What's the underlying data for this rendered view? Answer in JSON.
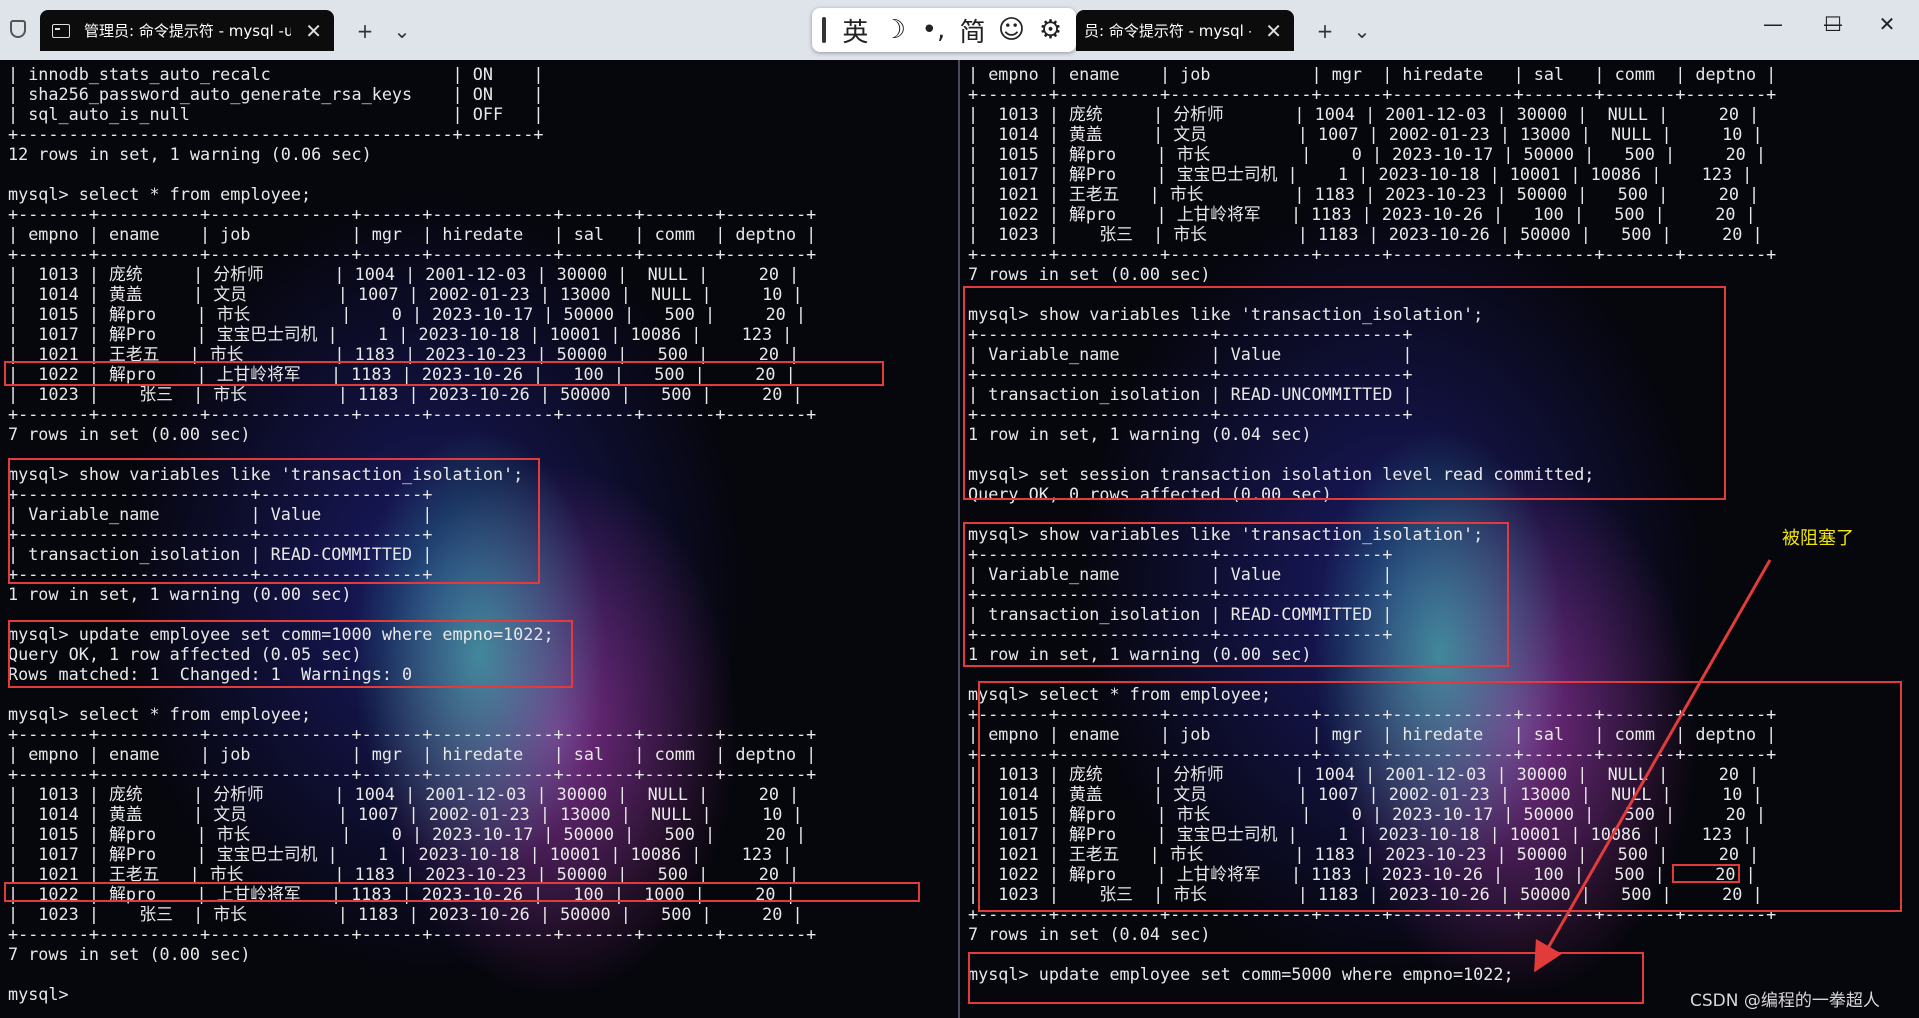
{
  "window": {
    "tabs": [
      {
        "title": "管理员: 命令提示符 - mysql  -u"
      },
      {
        "title": "员: 命令提示符 - mysql  -u"
      }
    ],
    "new_tab_symbol": "+",
    "dropdown_symbol": "⌄",
    "close_symbol": "✕",
    "controls": {
      "minimize": "—",
      "maximize": "☐",
      "close": "✕"
    }
  },
  "ime": {
    "lang": "英",
    "moon": "☽",
    "punct": "•,",
    "simplified": "简",
    "emoji": "☺",
    "settings": "⚙"
  },
  "left_terminal": {
    "lines": [
      "| innodb_stats_auto_recalc                  | ON    |",
      "| sha256_password_auto_generate_rsa_keys    | ON    |",
      "| sql_auto_is_null                          | OFF   |",
      "+-------------------------------------------+-------+",
      "12 rows in set, 1 warning (0.06 sec)",
      "",
      "mysql> select * from employee;",
      "+-------+----------+--------------+------+------------+-------+-------+--------+",
      "| empno | ename    | job          | mgr  | hiredate   | sal   | comm  | deptno |",
      "+-------+----------+--------------+------+------------+-------+-------+--------+",
      "|  1013 | 庞统     | 分析师       | 1004 | 2001-12-03 | 30000 |  NULL |     20 |",
      "|  1014 | 黄盖     | 文员         | 1007 | 2002-01-23 | 13000 |  NULL |     10 |",
      "|  1015 | 解pro    | 市长         |    0 | 2023-10-17 | 50000 |   500 |     20 |",
      "|  1017 | 解Pro    | 宝宝巴士司机 |    1 | 2023-10-18 | 10001 | 10086 |    123 |",
      "|  1021 | 王老五   | 市长         | 1183 | 2023-10-23 | 50000 |   500 |     20 |",
      "|  1022 | 解pro    | 上甘岭将军   | 1183 | 2023-10-26 |   100 |   500 |     20 |",
      "|  1023 |    张三  | 市长         | 1183 | 2023-10-26 | 50000 |   500 |     20 |",
      "+-------+----------+--------------+------+------------+-------+-------+--------+",
      "7 rows in set (0.00 sec)",
      "",
      "mysql> show variables like 'transaction_isolation';",
      "+-----------------------+----------------+",
      "| Variable_name         | Value          |",
      "+-----------------------+----------------+",
      "| transaction_isolation | READ-COMMITTED |",
      "+-----------------------+----------------+",
      "1 row in set, 1 warning (0.00 sec)",
      "",
      "mysql> update employee set comm=1000 where empno=1022;",
      "Query OK, 1 row affected (0.05 sec)",
      "Rows matched: 1  Changed: 1  Warnings: 0",
      "",
      "mysql> select * from employee;",
      "+-------+----------+--------------+------+------------+-------+-------+--------+",
      "| empno | ename    | job          | mgr  | hiredate   | sal   | comm  | deptno |",
      "+-------+----------+--------------+------+------------+-------+-------+--------+",
      "|  1013 | 庞统     | 分析师       | 1004 | 2001-12-03 | 30000 |  NULL |     20 |",
      "|  1014 | 黄盖     | 文员         | 1007 | 2002-01-23 | 13000 |  NULL |     10 |",
      "|  1015 | 解pro    | 市长         |    0 | 2023-10-17 | 50000 |   500 |     20 |",
      "|  1017 | 解Pro    | 宝宝巴士司机 |    1 | 2023-10-18 | 10001 | 10086 |    123 |",
      "|  1021 | 王老五   | 市长         | 1183 | 2023-10-23 | 50000 |   500 |     20 |",
      "|  1022 | 解pro    | 上甘岭将军   | 1183 | 2023-10-26 |   100 |  1000 |     20 |",
      "|  1023 |    张三  | 市长         | 1183 | 2023-10-26 | 50000 |   500 |     20 |",
      "+-------+----------+--------------+------+------------+-------+-------+--------+",
      "7 rows in set (0.00 sec)",
      "",
      "mysql>"
    ]
  },
  "right_terminal": {
    "lines": [
      "| empno | ename    | job          | mgr  | hiredate   | sal   | comm  | deptno |",
      "+-------+----------+--------------+------+------------+-------+-------+--------+",
      "|  1013 | 庞统     | 分析师       | 1004 | 2001-12-03 | 30000 |  NULL |     20 |",
      "|  1014 | 黄盖     | 文员         | 1007 | 2002-01-23 | 13000 |  NULL |     10 |",
      "|  1015 | 解pro    | 市长         |    0 | 2023-10-17 | 50000 |   500 |     20 |",
      "|  1017 | 解Pro    | 宝宝巴士司机 |    1 | 2023-10-18 | 10001 | 10086 |    123 |",
      "|  1021 | 王老五   | 市长         | 1183 | 2023-10-23 | 50000 |   500 |     20 |",
      "|  1022 | 解pro    | 上甘岭将军   | 1183 | 2023-10-26 |   100 |   500 |     20 |",
      "|  1023 |    张三  | 市长         | 1183 | 2023-10-26 | 50000 |   500 |     20 |",
      "+-------+----------+--------------+------+------------+-------+-------+--------+",
      "7 rows in set (0.00 sec)",
      "",
      "mysql> show variables like 'transaction_isolation';",
      "+-----------------------+------------------+",
      "| Variable_name         | Value            |",
      "+-----------------------+------------------+",
      "| transaction_isolation | READ-UNCOMMITTED |",
      "+-----------------------+------------------+",
      "1 row in set, 1 warning (0.04 sec)",
      "",
      "mysql> set session transaction isolation level read committed;",
      "Query OK, 0 rows affected (0.00 sec)",
      "",
      "mysql> show variables like 'transaction_isolation';",
      "+-----------------------+----------------+",
      "| Variable_name         | Value          |",
      "+-----------------------+----------------+",
      "| transaction_isolation | READ-COMMITTED |",
      "+-----------------------+----------------+",
      "1 row in set, 1 warning (0.00 sec)",
      "",
      "mysql> select * from employee;",
      "+-------+----------+--------------+------+------------+-------+-------+--------+",
      "| empno | ename    | job          | mgr  | hiredate   | sal   | comm  | deptno |",
      "+-------+----------+--------------+------+------------+-------+-------+--------+",
      "|  1013 | 庞统     | 分析师       | 1004 | 2001-12-03 | 30000 |  NULL |     20 |",
      "|  1014 | 黄盖     | 文员         | 1007 | 2002-01-23 | 13000 |  NULL |     10 |",
      "|  1015 | 解pro    | 市长         |    0 | 2023-10-17 | 50000 |   500 |     20 |",
      "|  1017 | 解Pro    | 宝宝巴士司机 |    1 | 2023-10-18 | 10001 | 10086 |    123 |",
      "|  1021 | 王老五   | 市长         | 1183 | 2023-10-23 | 50000 |   500 |     20 |",
      "|  1022 | 解pro    | 上甘岭将军   | 1183 | 2023-10-26 |   100 |   500 |     20 |",
      "|  1023 |    张三  | 市长         | 1183 | 2023-10-26 | 50000 |   500 |     20 |",
      "+-------+----------+--------------+------+------------+-------+-------+--------+",
      "7 rows in set (0.04 sec)",
      "",
      "mysql> update employee set comm=5000 where empno=1022;"
    ]
  },
  "annotation": {
    "text": "被阻塞了",
    "color": "#f2e600"
  },
  "watermark": "CSDN @编程的一拳超人",
  "colors": {
    "highlight_box": "#e23b3b",
    "terminal_text": "#e8e8e8",
    "title_bar": "#dfe3ea"
  }
}
